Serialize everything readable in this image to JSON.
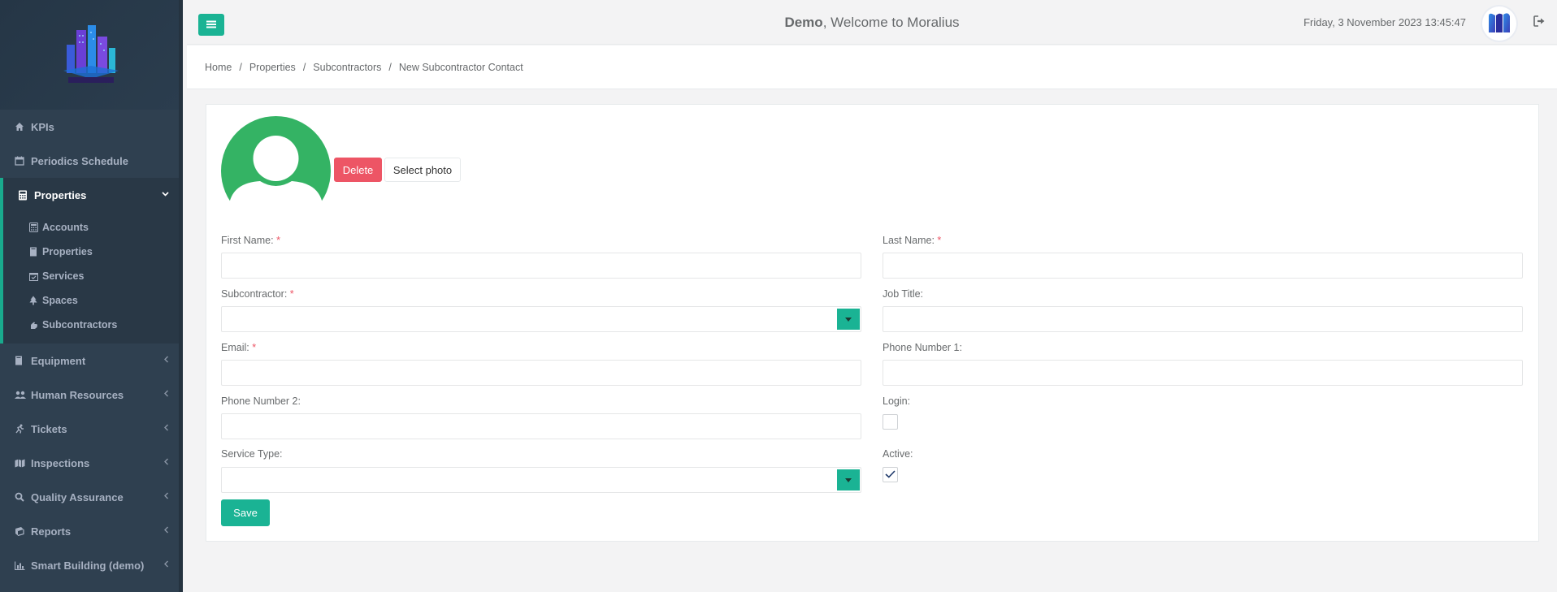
{
  "sidebar": {
    "items": [
      {
        "label": "KPIs",
        "icon": "home-icon"
      },
      {
        "label": "Periodics Schedule",
        "icon": "calendar-icon"
      },
      {
        "label": "Properties",
        "icon": "calculator-icon"
      },
      {
        "label": "Equipment",
        "icon": "book-icon"
      },
      {
        "label": "Human Resources",
        "icon": "users-icon"
      },
      {
        "label": "Tickets",
        "icon": "runner-icon"
      },
      {
        "label": "Inspections",
        "icon": "map-icon"
      },
      {
        "label": "Quality Assurance",
        "icon": "magnifier-icon"
      },
      {
        "label": "Reports",
        "icon": "books-icon"
      },
      {
        "label": "Smart Building (demo)",
        "icon": "bar-chart-icon"
      }
    ],
    "subitems": [
      {
        "label": "Accounts",
        "icon": "calculator-icon"
      },
      {
        "label": "Properties",
        "icon": "book-icon"
      },
      {
        "label": "Services",
        "icon": "calendar-check-icon"
      },
      {
        "label": "Spaces",
        "icon": "tree-icon"
      },
      {
        "label": "Subcontractors",
        "icon": "hand-icon"
      }
    ]
  },
  "header": {
    "welcome_bold": "Demo",
    "welcome_rest": ", Welcome to Moralius",
    "datetime": "Friday, 3 November 2023 13:45:47"
  },
  "breadcrumb": [
    "Home",
    "Properties",
    "Subcontractors",
    "New Subcontractor Contact"
  ],
  "breadcrumb_sep": "/",
  "photo": {
    "delete_label": "Delete",
    "select_label": "Select photo"
  },
  "form": {
    "first_name_label": "First Name:",
    "last_name_label": "Last Name:",
    "subcontractor_label": "Subcontractor:",
    "job_title_label": "Job Title:",
    "email_label": "Email:",
    "phone1_label": "Phone Number 1:",
    "phone2_label": "Phone Number 2:",
    "login_label": "Login:",
    "service_type_label": "Service Type:",
    "active_label": "Active:",
    "required_mark": "*",
    "first_name_value": "",
    "last_name_value": "",
    "subcontractor_value": "",
    "job_title_value": "",
    "email_value": "",
    "phone1_value": "",
    "phone2_value": "",
    "service_type_value": "",
    "login_checked": false,
    "active_checked": true,
    "save_label": "Save"
  },
  "colors": {
    "sidebar_bg": "#2f4050",
    "accent": "#1ab394",
    "danger": "#ed5565",
    "avatar_green": "#34b364"
  }
}
